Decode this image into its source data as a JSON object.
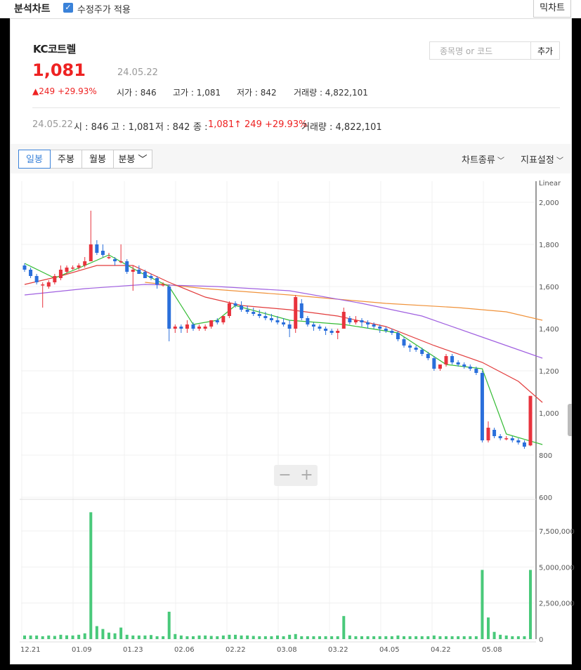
{
  "header": {
    "title": "분석차트",
    "checkbox_label": "수정주가 적용",
    "right_button": "믹차트"
  },
  "stock": {
    "name": "KC코트렐",
    "price": "1,081",
    "date": "24.05.22",
    "change": "249 +29.93%",
    "open_label": "시가",
    "open": "846",
    "high_label": "고가",
    "high": "1,081",
    "low_label": "저가",
    "low": "842",
    "vol_label": "거래량",
    "volume": "4,822,101"
  },
  "search": {
    "placeholder": "종목명 or 코드",
    "add_label": "추가"
  },
  "info": {
    "date": "24.05.22",
    "o": "시 : 846",
    "h": "고 : 1,081",
    "l": "저 : 842",
    "c_label": "종 :",
    "c": "1,081",
    "chg": "249 +29.93%",
    "vol": "거래량 : 4,822,101"
  },
  "tabs": [
    {
      "label": "일봉"
    },
    {
      "label": "주봉"
    },
    {
      "label": "월봉"
    },
    {
      "label": "분봉"
    }
  ],
  "menus": {
    "chart_type": "차트종류",
    "indicator": "지표설정"
  },
  "colors": {
    "up": "#e8333d",
    "down": "#2a6fdb",
    "ma5": "#33bb33",
    "ma20": "#e23b3b",
    "ma60": "#a060e0",
    "ma120": "#f0923a",
    "volume": "#49c97a"
  },
  "chart_data": {
    "type": "candlestick",
    "scale_label": "Linear",
    "ylim": [
      600,
      2100
    ],
    "y_ticks": [
      "2,000",
      "1,800",
      "1,600",
      "1,400",
      "1,200",
      "1,000",
      "800",
      "600"
    ],
    "vol_ylim": [
      0,
      9500000
    ],
    "vol_ticks": [
      "7,500,000",
      "5,000,000",
      "2,500,000",
      "0"
    ],
    "x_labels": [
      "12.21",
      "01.09",
      "01.23",
      "02.06",
      "02.22",
      "03.08",
      "03.22",
      "04.05",
      "04.22",
      "05.08"
    ],
    "candles": [
      [
        1700,
        1710,
        1670,
        1680
      ],
      [
        1680,
        1690,
        1640,
        1650
      ],
      [
        1650,
        1660,
        1610,
        1620
      ],
      [
        1610,
        1620,
        1500,
        1610
      ],
      [
        1600,
        1630,
        1590,
        1620
      ],
      [
        1620,
        1660,
        1610,
        1650
      ],
      [
        1640,
        1700,
        1630,
        1680
      ],
      [
        1670,
        1700,
        1660,
        1690
      ],
      [
        1690,
        1700,
        1680,
        1690
      ],
      [
        1690,
        1710,
        1680,
        1700
      ],
      [
        1700,
        1740,
        1690,
        1720
      ],
      [
        1720,
        1960,
        1720,
        1800
      ],
      [
        1800,
        1820,
        1750,
        1760
      ],
      [
        1770,
        1800,
        1740,
        1750
      ],
      [
        1740,
        1760,
        1730,
        1740
      ],
      [
        1730,
        1740,
        1700,
        1720
      ],
      [
        1720,
        1800,
        1710,
        1720
      ],
      [
        1720,
        1730,
        1660,
        1670
      ],
      [
        1670,
        1700,
        1580,
        1680
      ],
      [
        1680,
        1700,
        1660,
        1660
      ],
      [
        1670,
        1680,
        1640,
        1640
      ],
      [
        1650,
        1660,
        1630,
        1640
      ],
      [
        1640,
        1650,
        1590,
        1610
      ],
      [
        1610,
        1620,
        1600,
        1610
      ],
      [
        1600,
        1610,
        1340,
        1400
      ],
      [
        1400,
        1420,
        1380,
        1410
      ],
      [
        1410,
        1420,
        1380,
        1400
      ],
      [
        1400,
        1440,
        1380,
        1420
      ],
      [
        1420,
        1430,
        1390,
        1400
      ],
      [
        1400,
        1420,
        1390,
        1410
      ],
      [
        1400,
        1420,
        1390,
        1410
      ],
      [
        1410,
        1440,
        1400,
        1440
      ],
      [
        1440,
        1450,
        1420,
        1430
      ],
      [
        1430,
        1460,
        1420,
        1460
      ],
      [
        1460,
        1530,
        1450,
        1520
      ],
      [
        1520,
        1530,
        1500,
        1510
      ],
      [
        1510,
        1530,
        1480,
        1490
      ],
      [
        1490,
        1510,
        1470,
        1480
      ],
      [
        1480,
        1500,
        1460,
        1470
      ],
      [
        1470,
        1490,
        1450,
        1460
      ],
      [
        1460,
        1480,
        1440,
        1450
      ],
      [
        1450,
        1470,
        1430,
        1440
      ],
      [
        1440,
        1460,
        1420,
        1430
      ],
      [
        1430,
        1450,
        1410,
        1420
      ],
      [
        1420,
        1440,
        1360,
        1400
      ],
      [
        1400,
        1560,
        1380,
        1550
      ],
      [
        1520,
        1540,
        1440,
        1450
      ],
      [
        1450,
        1460,
        1410,
        1420
      ],
      [
        1420,
        1430,
        1390,
        1410
      ],
      [
        1410,
        1420,
        1390,
        1400
      ],
      [
        1400,
        1410,
        1370,
        1390
      ],
      [
        1390,
        1400,
        1370,
        1380
      ],
      [
        1380,
        1400,
        1350,
        1390
      ],
      [
        1400,
        1500,
        1400,
        1480
      ],
      [
        1450,
        1460,
        1420,
        1430
      ],
      [
        1430,
        1460,
        1420,
        1440
      ],
      [
        1440,
        1450,
        1410,
        1430
      ],
      [
        1430,
        1440,
        1400,
        1420
      ],
      [
        1420,
        1430,
        1400,
        1410
      ],
      [
        1410,
        1420,
        1380,
        1400
      ],
      [
        1400,
        1410,
        1380,
        1390
      ],
      [
        1390,
        1400,
        1370,
        1380
      ],
      [
        1380,
        1390,
        1340,
        1350
      ],
      [
        1350,
        1360,
        1310,
        1320
      ],
      [
        1320,
        1330,
        1290,
        1310
      ],
      [
        1310,
        1320,
        1290,
        1300
      ],
      [
        1300,
        1310,
        1270,
        1280
      ],
      [
        1280,
        1290,
        1250,
        1260
      ],
      [
        1260,
        1270,
        1200,
        1210
      ],
      [
        1210,
        1230,
        1200,
        1230
      ],
      [
        1230,
        1280,
        1220,
        1270
      ],
      [
        1270,
        1280,
        1230,
        1240
      ],
      [
        1240,
        1250,
        1220,
        1230
      ],
      [
        1230,
        1240,
        1210,
        1220
      ],
      [
        1220,
        1230,
        1200,
        1210
      ],
      [
        1210,
        1220,
        1180,
        1190
      ],
      [
        1190,
        1200,
        860,
        870
      ],
      [
        870,
        960,
        860,
        930
      ],
      [
        920,
        930,
        880,
        890
      ],
      [
        890,
        900,
        870,
        880
      ],
      [
        880,
        890,
        870,
        880
      ],
      [
        880,
        890,
        860,
        870
      ],
      [
        870,
        880,
        850,
        860
      ],
      [
        860,
        870,
        830,
        840
      ],
      [
        846,
        1081,
        842,
        1081
      ]
    ],
    "ma5": [
      [
        0,
        1710
      ],
      [
        5,
        1640
      ],
      [
        10,
        1700
      ],
      [
        14,
        1750
      ],
      [
        19,
        1670
      ],
      [
        24,
        1600
      ],
      [
        28,
        1420
      ],
      [
        32,
        1440
      ],
      [
        35,
        1510
      ],
      [
        44,
        1440
      ],
      [
        53,
        1420
      ],
      [
        62,
        1380
      ],
      [
        70,
        1230
      ],
      [
        76,
        1210
      ],
      [
        80,
        900
      ],
      [
        86,
        850
      ]
    ],
    "ma20": [
      [
        0,
        1610
      ],
      [
        6,
        1650
      ],
      [
        12,
        1700
      ],
      [
        18,
        1700
      ],
      [
        24,
        1620
      ],
      [
        30,
        1550
      ],
      [
        36,
        1510
      ],
      [
        44,
        1490
      ],
      [
        52,
        1460
      ],
      [
        60,
        1410
      ],
      [
        68,
        1320
      ],
      [
        76,
        1240
      ],
      [
        82,
        1150
      ],
      [
        86,
        1050
      ]
    ],
    "ma60": [
      [
        0,
        1560
      ],
      [
        10,
        1590
      ],
      [
        20,
        1610
      ],
      [
        32,
        1600
      ],
      [
        44,
        1580
      ],
      [
        56,
        1520
      ],
      [
        66,
        1460
      ],
      [
        76,
        1360
      ],
      [
        86,
        1260
      ]
    ],
    "ma120": [
      [
        20,
        1620
      ],
      [
        30,
        1590
      ],
      [
        44,
        1560
      ],
      [
        60,
        1520
      ],
      [
        72,
        1500
      ],
      [
        80,
        1480
      ],
      [
        86,
        1440
      ]
    ],
    "volume": [
      250000,
      250000,
      250000,
      200000,
      250000,
      220000,
      300000,
      260000,
      250000,
      300000,
      400000,
      8800000,
      900000,
      700000,
      450000,
      400000,
      800000,
      300000,
      250000,
      250000,
      250000,
      280000,
      200000,
      200000,
      1900000,
      350000,
      250000,
      200000,
      200000,
      250000,
      250000,
      220000,
      200000,
      250000,
      300000,
      300000,
      250000,
      250000,
      220000,
      200000,
      200000,
      200000,
      250000,
      200000,
      300000,
      350000,
      200000,
      200000,
      200000,
      200000,
      200000,
      200000,
      200000,
      1600000,
      250000,
      200000,
      200000,
      200000,
      200000,
      200000,
      200000,
      200000,
      250000,
      200000,
      200000,
      200000,
      200000,
      200000,
      250000,
      200000,
      200000,
      200000,
      200000,
      200000,
      200000,
      200000,
      4800000,
      1500000,
      500000,
      300000,
      250000,
      200000,
      200000,
      200000,
      4800000
    ]
  }
}
